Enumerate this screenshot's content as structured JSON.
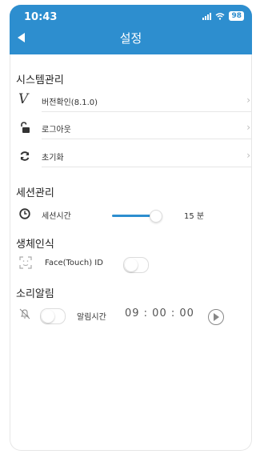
{
  "status": {
    "time": "10:43",
    "battery": "98"
  },
  "header": {
    "title": "설정"
  },
  "sections": {
    "system": {
      "title": "시스템관리",
      "items": [
        {
          "label": "버전확인(8.1.0)",
          "icon": "version-v-icon"
        },
        {
          "label": "로그아웃",
          "icon": "unlock-icon"
        },
        {
          "label": "초기화",
          "icon": "refresh-icon"
        }
      ]
    },
    "session": {
      "title": "세션관리",
      "label": "세션시간",
      "value": "15 분",
      "slider_fraction": 0.8
    },
    "biometric": {
      "title": "생체인식",
      "label": "Face(Touch) ID",
      "enabled": false
    },
    "sound": {
      "title": "소리알림",
      "enabled": false,
      "label": "알림시간",
      "time": "09 : 00 : 00"
    }
  },
  "colors": {
    "accent": "#2d8ecf"
  }
}
